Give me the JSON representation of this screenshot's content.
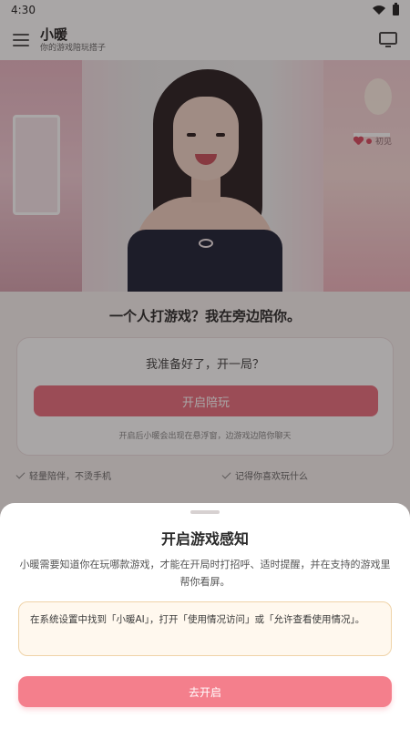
{
  "status_bar": {
    "time": "4:30"
  },
  "app_bar": {
    "title": "小暖",
    "subtitle": "你的游戏陪玩搭子",
    "menu_icon": "menu-icon",
    "cast_icon": "tv-icon"
  },
  "hero": {
    "badge_text": "初见"
  },
  "main": {
    "tagline": "一个人打游戏？我在旁边陪你。",
    "card": {
      "title": "我准备好了，开一局？",
      "button_label": "开启陪玩",
      "note": "开启后小暖会出现在悬浮窗，边游戏边陪你聊天"
    },
    "features": [
      {
        "label": "轻量陪伴，不烫手机"
      },
      {
        "label": "记得你喜欢玩什么"
      }
    ]
  },
  "sheet": {
    "title": "开启游戏感知",
    "description": "小暖需要知道你在玩哪款游戏，才能在开局时打招呼、适时提醒，并在支持的游戏里帮你看屏。",
    "hint": "在系统设置中找到「小暖AI」，打开「使用情况访问」或「允许查看使用情况」。",
    "button_label": "去开启"
  },
  "colors": {
    "accent": "#f47f8c",
    "accent_dark": "#e96f7f",
    "hint_bg": "#fff8ee",
    "hint_border": "#efd3a8"
  }
}
